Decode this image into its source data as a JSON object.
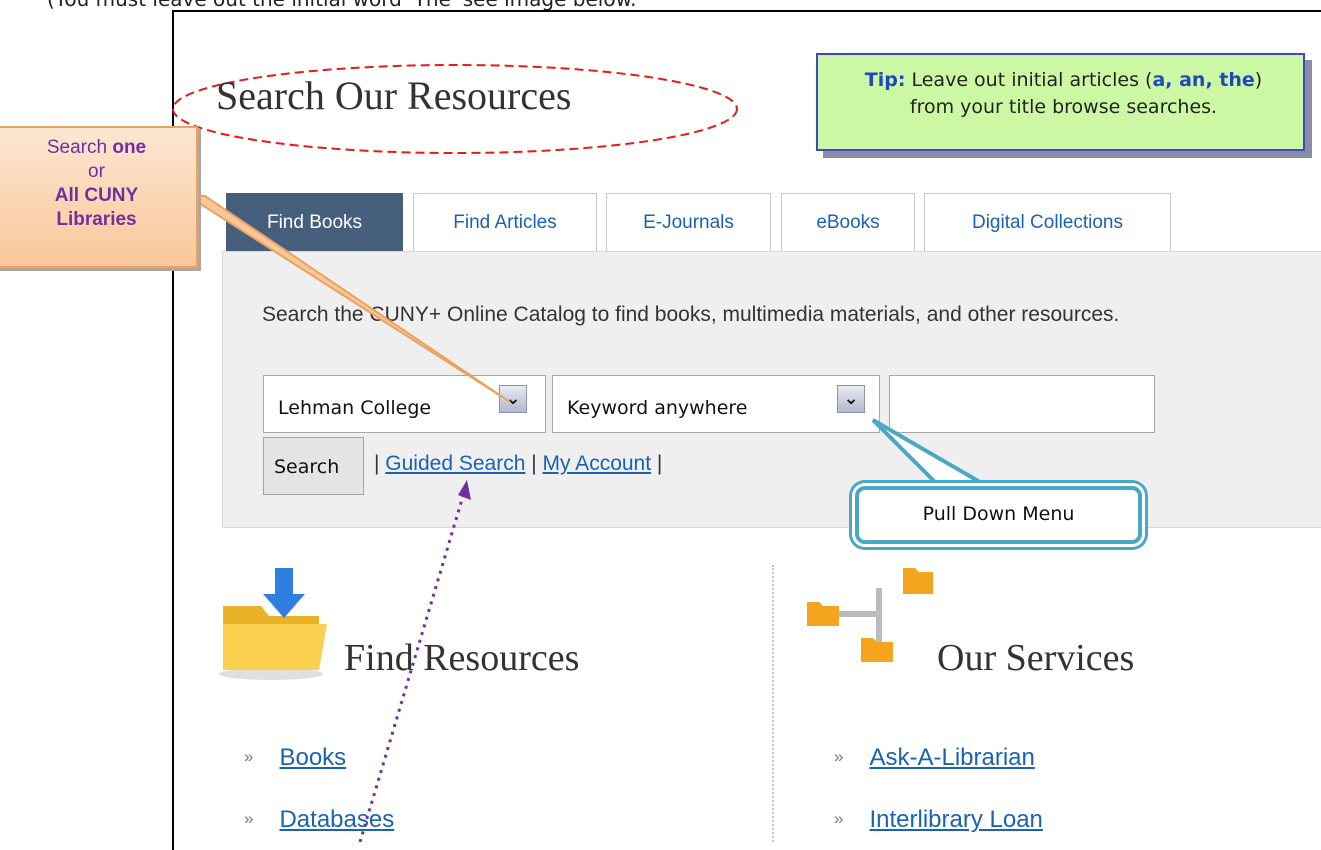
{
  "caption": "(You must leave out the initial word 'The' see image below.",
  "header": {
    "title": "Search Our Resources"
  },
  "tip": {
    "label": "Tip:",
    "text_1": " Leave out initial articles (",
    "articles": "a, an, the",
    "text_2": ") from your title browse searches."
  },
  "callout_left": {
    "line1": "Search ",
    "one": "one",
    "or": "or",
    "line3": "All CUNY",
    "line4": "Libraries"
  },
  "tabs": [
    {
      "label": "Find Books"
    },
    {
      "label": "Find Articles"
    },
    {
      "label": "E-Journals"
    },
    {
      "label": "eBooks"
    },
    {
      "label": "Digital Collections"
    }
  ],
  "search": {
    "description": "Search the CUNY+ Online Catalog to find books, multimedia materials, and other resources.",
    "library_select": "Lehman College",
    "field_select": "Keyword anywhere",
    "button_label": "Search",
    "sep1": " | ",
    "guided_search": "Guided Search",
    "sep2": " | ",
    "my_account": "My Account",
    "sep3": " |"
  },
  "callout_bottom": {
    "text": "Pull Down Menu"
  },
  "find_resources": {
    "title": "Find Resources",
    "items": [
      {
        "label": "Books"
      },
      {
        "label": "Databases"
      }
    ]
  },
  "our_services": {
    "title": "Our Services",
    "items": [
      {
        "label": "Ask-A-Librarian"
      },
      {
        "label": "Interlibrary Loan"
      }
    ]
  },
  "bullet": "»",
  "colors": {
    "accent_link": "#1a63b0",
    "active_tab": "#465f7c",
    "tip_bg": "#cdf8a3",
    "callout_purple": "#7030a0"
  },
  "icons": {
    "chevron": "chevron-down-icon",
    "folder_download": "folder-download-icon",
    "folder_network": "folder-network-icon"
  }
}
